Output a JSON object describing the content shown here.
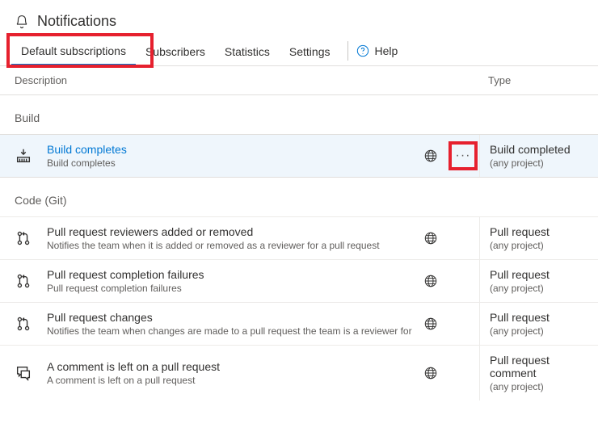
{
  "header": {
    "title": "Notifications"
  },
  "tabs": {
    "items": [
      {
        "label": "Default subscriptions"
      },
      {
        "label": "Subscribers"
      },
      {
        "label": "Statistics"
      },
      {
        "label": "Settings"
      }
    ],
    "help_label": "Help"
  },
  "columns": {
    "description": "Description",
    "type": "Type"
  },
  "sections": [
    {
      "title": "Build",
      "rows": [
        {
          "icon": "build",
          "title": "Build completes",
          "sub": "Build completes",
          "selected": true,
          "show_more": true,
          "type_title": "Build completed",
          "type_sub": "(any project)"
        }
      ]
    },
    {
      "title": "Code (Git)",
      "rows": [
        {
          "icon": "pr",
          "title": "Pull request reviewers added or removed",
          "sub": "Notifies the team when it is added or removed as a reviewer for a pull request",
          "type_title": "Pull request",
          "type_sub": "(any project)"
        },
        {
          "icon": "pr",
          "title": "Pull request completion failures",
          "sub": "Pull request completion failures",
          "type_title": "Pull request",
          "type_sub": "(any project)"
        },
        {
          "icon": "pr",
          "title": "Pull request changes",
          "sub": "Notifies the team when changes are made to a pull request the team is a reviewer for",
          "type_title": "Pull request",
          "type_sub": "(any project)"
        },
        {
          "icon": "comment",
          "title": "A comment is left on a pull request",
          "sub": "A comment is left on a pull request",
          "type_title": "Pull request comment",
          "type_sub": "(any project)"
        }
      ]
    }
  ]
}
